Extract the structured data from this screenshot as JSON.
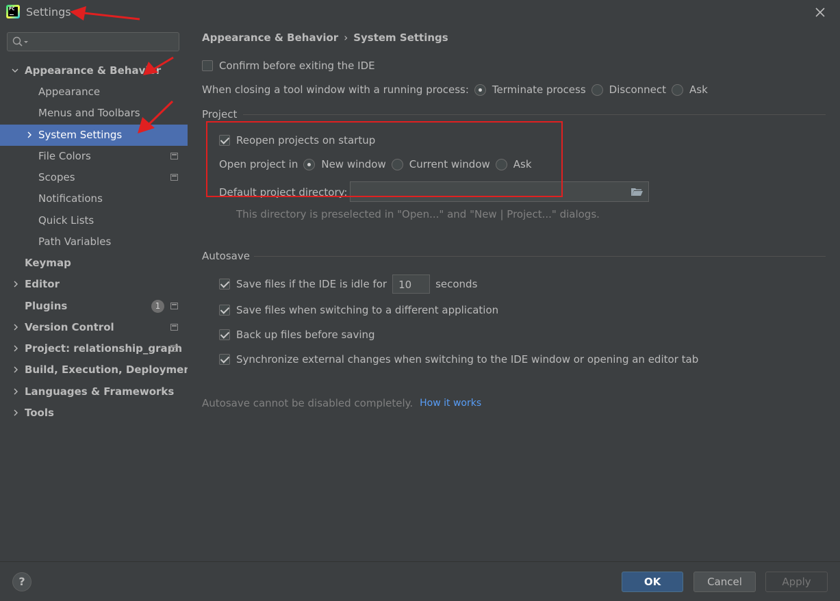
{
  "window": {
    "title": "Settings",
    "app_icon_text": "PC"
  },
  "sidebar": {
    "search_placeholder": "",
    "items": [
      {
        "label": "Appearance & Behavior",
        "expanded": true
      },
      {
        "label": "Appearance"
      },
      {
        "label": "Menus and Toolbars"
      },
      {
        "label": "System Settings",
        "selected": true
      },
      {
        "label": "File Colors"
      },
      {
        "label": "Scopes"
      },
      {
        "label": "Notifications"
      },
      {
        "label": "Quick Lists"
      },
      {
        "label": "Path Variables"
      },
      {
        "label": "Keymap"
      },
      {
        "label": "Editor"
      },
      {
        "label": "Plugins",
        "badge": "1"
      },
      {
        "label": "Version Control"
      },
      {
        "label": "Project: relationship_graph"
      },
      {
        "label": "Build, Execution, Deployment"
      },
      {
        "label": "Languages & Frameworks"
      },
      {
        "label": "Tools"
      }
    ]
  },
  "main": {
    "breadcrumb": {
      "parent": "Appearance & Behavior",
      "separator": "›",
      "current": "System Settings"
    },
    "confirm_exit": {
      "label": "Confirm before exiting the IDE",
      "checked": false
    },
    "tool_window": {
      "label": "When closing a tool window with a running process:",
      "options": [
        "Terminate process",
        "Disconnect",
        "Ask"
      ],
      "selected": "Terminate process"
    },
    "project": {
      "title": "Project",
      "reopen": {
        "label": "Reopen projects on startup",
        "checked": true
      },
      "open_in": {
        "label": "Open project in",
        "options": [
          "New window",
          "Current window",
          "Ask"
        ],
        "selected": "New window"
      },
      "default_dir": {
        "label": "Default project directory:",
        "value": ""
      },
      "hint": "This directory is preselected in \"Open...\" and \"New | Project...\" dialogs."
    },
    "autosave": {
      "title": "Autosave",
      "idle": {
        "label_before": "Save files if the IDE is idle for",
        "value": "10",
        "label_after": "seconds",
        "checked": true
      },
      "switch_app": {
        "label": "Save files when switching to a different application",
        "checked": true
      },
      "backup": {
        "label": "Back up files before saving",
        "checked": true
      },
      "sync": {
        "label": "Synchronize external changes when switching to the IDE window or opening an editor tab",
        "checked": true
      },
      "note": "Autosave cannot be disabled completely.",
      "link": "How it works"
    }
  },
  "footer": {
    "help": "?",
    "ok": "OK",
    "cancel": "Cancel",
    "apply": "Apply"
  },
  "colors": {
    "background": "#3c3f41",
    "selection": "#4b6eaf",
    "ok_button": "#365880",
    "link": "#589df6",
    "annotation": "#e02020"
  }
}
